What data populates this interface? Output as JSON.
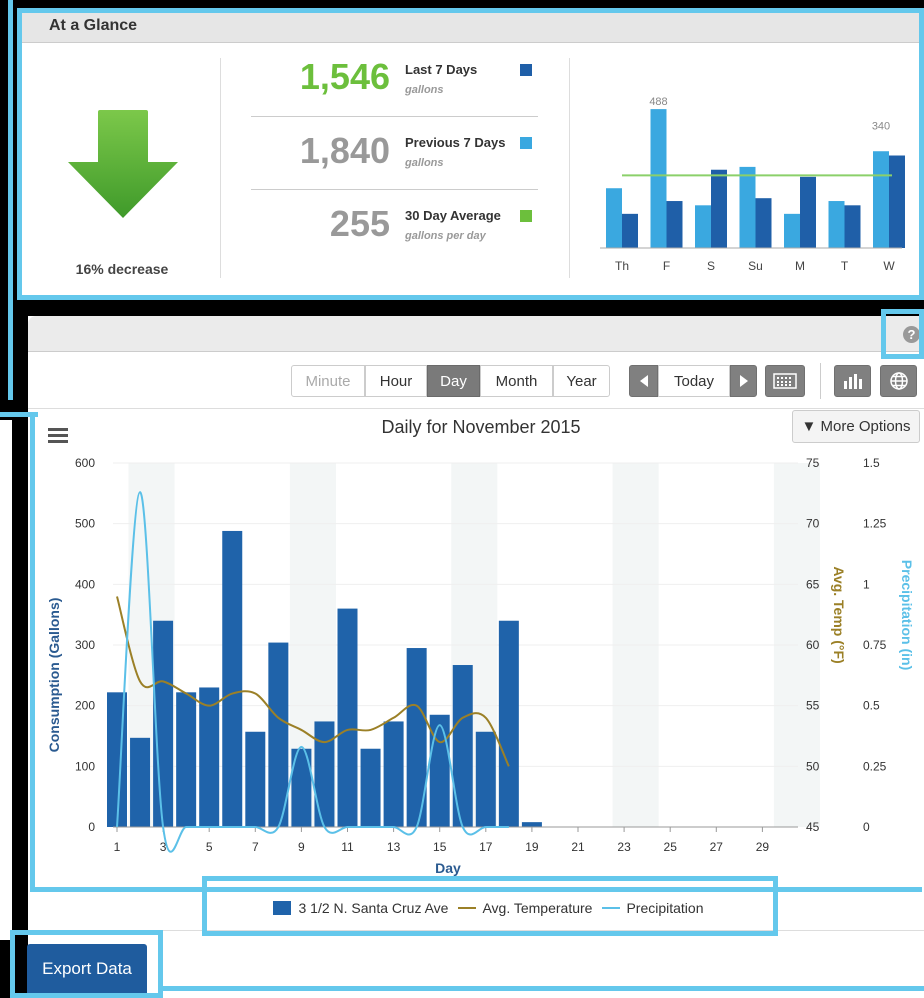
{
  "glance": {
    "title": "At a Glance",
    "change_text": "16% decrease",
    "stats": [
      {
        "value": "1,546",
        "label": "Last 7 Days",
        "unit": "gallons",
        "color": "#1f5fa8",
        "value_color": "#6cbf3c"
      },
      {
        "value": "1,840",
        "label": "Previous 7 Days",
        "unit": "gallons",
        "color": "#3aa8e0",
        "value_color": "#999999"
      },
      {
        "value": "255",
        "label": "30 Day Average",
        "unit": "gallons per day",
        "color": "#6cbf3c",
        "value_color": "#999999"
      }
    ],
    "mini_chart": {
      "type": "bar",
      "categories": [
        "Th",
        "F",
        "S",
        "Su",
        "M",
        "T",
        "W"
      ],
      "series": [
        {
          "values": [
            210,
            488,
            150,
            285,
            120,
            165,
            340
          ]
        },
        {
          "values": [
            120,
            165,
            275,
            175,
            250,
            150,
            325
          ]
        }
      ],
      "average_line": 255,
      "max_label": "488",
      "last_label": "340",
      "ylim": [
        0,
        520
      ]
    }
  },
  "toolbar": {
    "intervals": [
      "Minute",
      "Hour",
      "Day",
      "Month",
      "Year"
    ],
    "active_interval": "Day",
    "today_label": "Today",
    "more_options_label": "▼ More Options",
    "help_glyph": "?"
  },
  "chart_data": {
    "type": "bar",
    "title": "Daily for November 2015",
    "xlabel": "Day",
    "ylabel": "Consumption (Gallons)",
    "y2label": "Avg. Temp (°F)",
    "y3label": "Precipitation (in)",
    "x_ticks": [
      "1",
      "3",
      "5",
      "7",
      "9",
      "11",
      "13",
      "15",
      "17",
      "19",
      "21",
      "23",
      "25",
      "27",
      "29"
    ],
    "y_ticks": [
      "0",
      "100",
      "200",
      "300",
      "400",
      "500",
      "600"
    ],
    "y2_ticks": [
      "45",
      "50",
      "55",
      "60",
      "65",
      "70",
      "75"
    ],
    "y3_ticks": [
      "0",
      "0.25",
      "0.5",
      "0.75",
      "1",
      "1.25",
      "1.5"
    ],
    "ylim": [
      0,
      600
    ],
    "y2lim": [
      45,
      75
    ],
    "y3lim": [
      0,
      1.5
    ],
    "days": [
      1,
      2,
      3,
      4,
      5,
      6,
      7,
      8,
      9,
      10,
      11,
      12,
      13,
      14,
      15,
      16,
      17,
      18,
      19,
      20,
      21,
      22,
      23,
      24,
      25,
      26,
      27,
      28,
      29,
      30
    ],
    "series": [
      {
        "name": "3 1/2 N. Santa Cruz Ave",
        "type": "bar",
        "color": "#1f63aa",
        "values": [
          222,
          147,
          340,
          222,
          230,
          488,
          157,
          304,
          129,
          174,
          360,
          129,
          174,
          295,
          185,
          267,
          157,
          340,
          8,
          0,
          0,
          0,
          0,
          0,
          0,
          0,
          0,
          0,
          0,
          0
        ]
      },
      {
        "name": "Avg. Temperature",
        "type": "line",
        "color": "#9b8027",
        "values": [
          64,
          57,
          57,
          56,
          55,
          56,
          56,
          54,
          53,
          52,
          53,
          53,
          54,
          55,
          52,
          54,
          54,
          50
        ]
      },
      {
        "name": "Precipitation",
        "type": "line",
        "color": "#5bc0e8",
        "values": [
          0,
          1.38,
          0,
          0,
          0,
          0,
          0,
          0,
          0.33,
          0,
          0,
          0,
          0,
          0,
          0.42,
          0,
          0,
          0
        ]
      }
    ]
  },
  "legend": {
    "items": [
      "3 1/2 N. Santa Cruz Ave",
      "Avg. Temperature",
      "Precipitation"
    ]
  },
  "export_label": "Export Data"
}
